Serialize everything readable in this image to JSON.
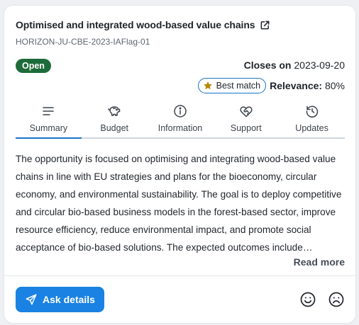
{
  "title": "Optimised and integrated wood-based value chains",
  "code": "HORIZON-JU-CBE-2023-IAFlag-01",
  "status": "Open",
  "closes": {
    "label": "Closes on",
    "date": "2023-09-20"
  },
  "best_match": "Best match",
  "relevance": {
    "label": "Relevance:",
    "value": "80%"
  },
  "tabs": [
    {
      "label": "Summary",
      "icon": "lines-icon",
      "active": true
    },
    {
      "label": "Budget",
      "icon": "piggy-bank-icon",
      "active": false
    },
    {
      "label": "Information",
      "icon": "info-icon",
      "active": false
    },
    {
      "label": "Support",
      "icon": "heart-handshake-icon",
      "active": false
    },
    {
      "label": "Updates",
      "icon": "history-icon",
      "active": false
    }
  ],
  "description": "The opportunity is focused on optimising and integrating wood-based value chains in line with EU strategies and plans for the bioeconomy, circular economy, and environmental sustainability. The goal is to deploy competitive and circular bio-based business models in the forest-based sector, improve resource efficiency, reduce environmental impact, and promote social acceptance of bio-based solutions. The expected outcomes include increased competitiveness and sustainability of the bio-based sector.",
  "read_more": "Read more",
  "ask_button": "Ask details",
  "colors": {
    "accent": "#1a82e2",
    "open_badge": "#1d6b3a",
    "star": "#b8860b",
    "tab_underline": "#1a73c9"
  }
}
